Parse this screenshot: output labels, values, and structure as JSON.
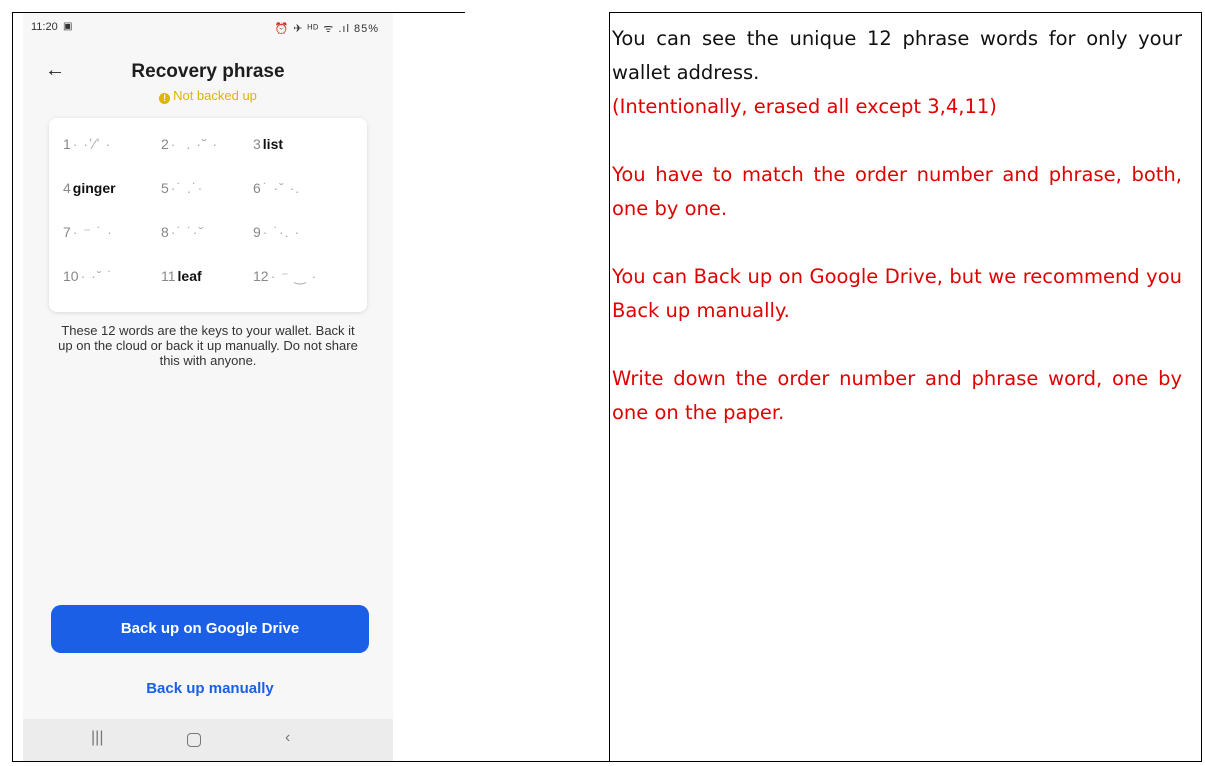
{
  "status_bar": {
    "time": "11:20",
    "icons": "⏰ ✈ ᴴᴰ ᯤ .ıl 85%",
    "battery": "85%"
  },
  "screen": {
    "title": "Recovery phrase",
    "backup_status": "Not backed up",
    "phrase_words": [
      {
        "num": "1",
        "word": "",
        "hidden": true
      },
      {
        "num": "2",
        "word": "",
        "hidden": true
      },
      {
        "num": "3",
        "word": "list",
        "hidden": false
      },
      {
        "num": "4",
        "word": "ginger",
        "hidden": false
      },
      {
        "num": "5",
        "word": "",
        "hidden": true
      },
      {
        "num": "6",
        "word": "",
        "hidden": true
      },
      {
        "num": "7",
        "word": "",
        "hidden": true
      },
      {
        "num": "8",
        "word": "",
        "hidden": true
      },
      {
        "num": "9",
        "word": "",
        "hidden": true
      },
      {
        "num": "10",
        "word": "",
        "hidden": true
      },
      {
        "num": "11",
        "word": "leaf",
        "hidden": false
      },
      {
        "num": "12",
        "word": "",
        "hidden": true
      }
    ],
    "explanation": "These 12 words are the keys to your wallet. Back it up on the cloud or back it up manually. Do not share this with anyone.",
    "drive_button": "Back up on Google Drive",
    "manual_button": "Back up manually"
  },
  "instructions": {
    "intro": "You can see the unique 12 phrase words for only your wallet address.",
    "erased_note": "(Intentionally, erased all except 3,4,11)",
    "match_note": "You have to match the order number and phrase, both, one by one.",
    "drive_note": "You can Back up on Google Drive, but we recommend you Back up manually.",
    "write_note": "Write down the order number and phrase word, one by one on the paper."
  },
  "colors": {
    "primary_button": "#1a5fe6",
    "warning": "#e0b400",
    "instruction_red": "#e00000"
  }
}
